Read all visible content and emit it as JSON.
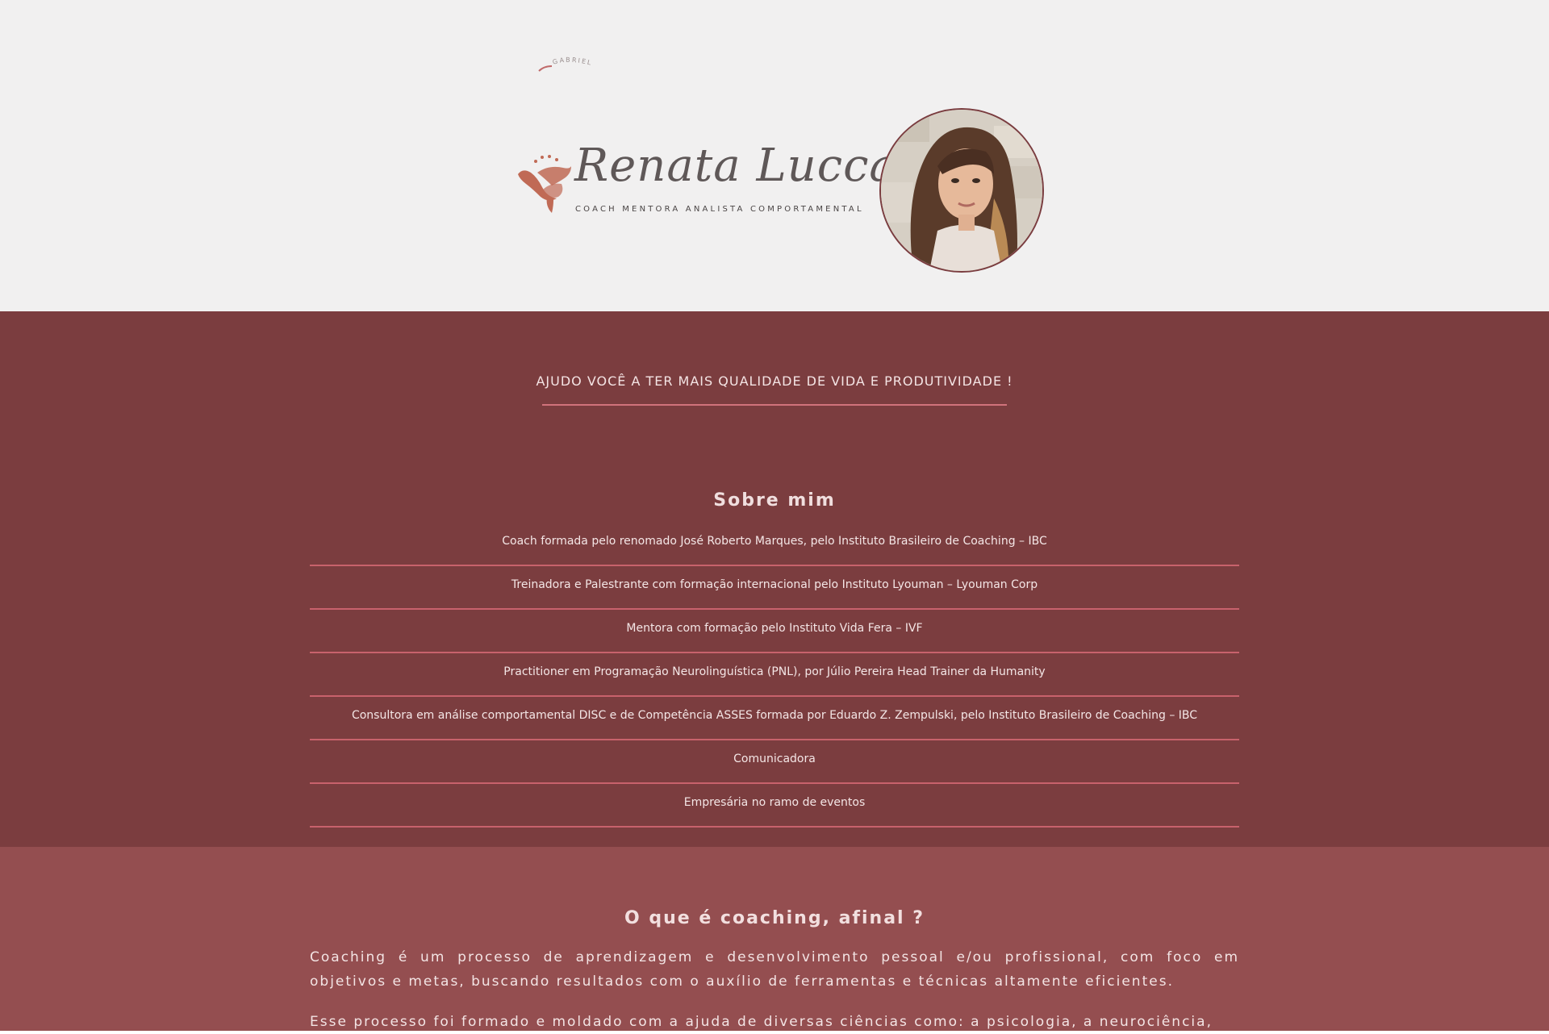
{
  "header": {
    "credit_mark": "GABRIEL",
    "logo": {
      "name": "Renata Lucca",
      "tagline": "COACH MENTORA ANALISTA COMPORTAMENTAL"
    }
  },
  "hero": {
    "headline": "AJUDO VOCÊ A TER MAIS QUALIDADE DE VIDA E PRODUTIVIDADE !"
  },
  "about": {
    "title": "Sobre mim",
    "items": [
      "Coach formada pelo renomado José Roberto Marques, pelo Instituto Brasileiro de Coaching – IBC",
      "Treinadora e Palestrante com formação internacional pelo Instituto Lyouman – Lyouman Corp",
      "Mentora com formação pelo Instituto Vida Fera – IVF",
      "Practitioner em Programação Neurolinguística (PNL), por Júlio Pereira Head Trainer da Humanity",
      "Consultora em análise comportamental DISC e de Competência ASSES formada por Eduardo Z. Zempulski, pelo Instituto Brasileiro de Coaching – IBC",
      "Comunicadora",
      "Empresária no ramo de eventos"
    ]
  },
  "coaching": {
    "title": "O que é coaching, afinal ?",
    "paragraphs": [
      "Coaching é um processo de aprendizagem e desenvolvimento pessoal e/ou profissional, com foco em objetivos e metas, buscando resultados com o auxílio de ferramentas e técnicas altamente eficientes.",
      "Esse processo foi formado e moldado com a ajuda de diversas ciências como: a psicologia, a neurociência,"
    ]
  },
  "colors": {
    "header_bg": "#f1f0f0",
    "dark_section": "#7b3d3f",
    "rose_section": "#944e50",
    "divider": "#c8626c",
    "accent": "#d1737c",
    "logo_copper": "#c06a55"
  },
  "icons": {
    "logo_emblem": "eagle-stars-emblem",
    "credit_mark": "curved-signature-mark"
  }
}
